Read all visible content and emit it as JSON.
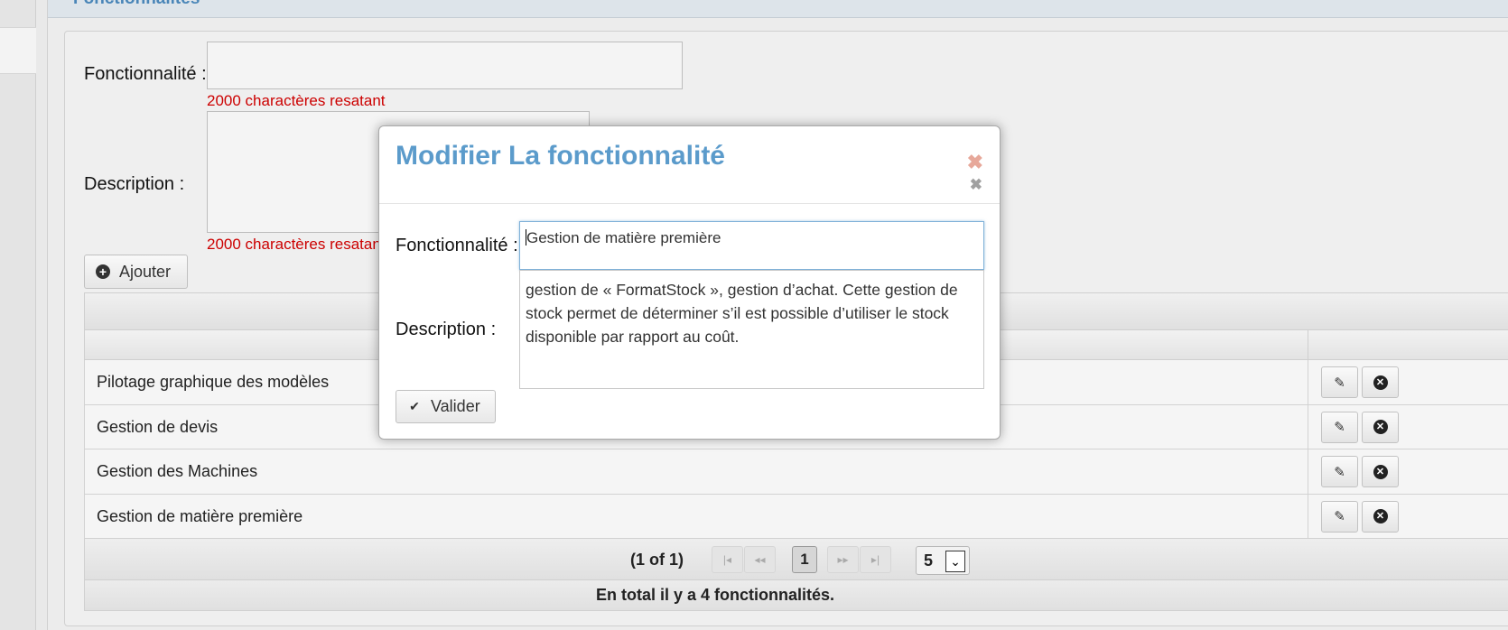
{
  "panel": {
    "title": "Fonctionnalités"
  },
  "form": {
    "feature_label": "Fonctionnalité :",
    "feature_remaining": "2000 charactères resatant",
    "description_label": "Description :",
    "description_remaining": "2000 charactères resatant",
    "add_button": "Ajouter"
  },
  "table": {
    "rows": [
      {
        "name": "Pilotage graphique des modèles"
      },
      {
        "name": "Gestion de devis"
      },
      {
        "name": "Gestion des Machines"
      },
      {
        "name": "Gestion de matière première"
      }
    ],
    "pager": {
      "info": "(1 of 1)",
      "current_page": "1",
      "rows_per_page": "5"
    },
    "footer": "En total il y a 4 fonctionnalités."
  },
  "modal": {
    "title": "Modifier La fonctionnalité",
    "feature_label": "Fonctionnalité :",
    "feature_value": "Gestion de matière première",
    "description_label": "Description :",
    "description_value": "gestion de « FormatStock », gestion d’achat. Cette gestion de stock permet de déterminer s’il est possible d’utiliser le stock disponible par rapport au coût.",
    "submit_button": "Valider"
  },
  "icons": {
    "add": "plus-circle-icon",
    "edit": "pencil-icon",
    "delete": "x-circle-icon",
    "submit": "check-icon",
    "close": "close-icon"
  },
  "colors": {
    "modal_title": "#5b9bcb",
    "remaining_text": "#cc0000",
    "close_primary": "#e7a89a"
  }
}
